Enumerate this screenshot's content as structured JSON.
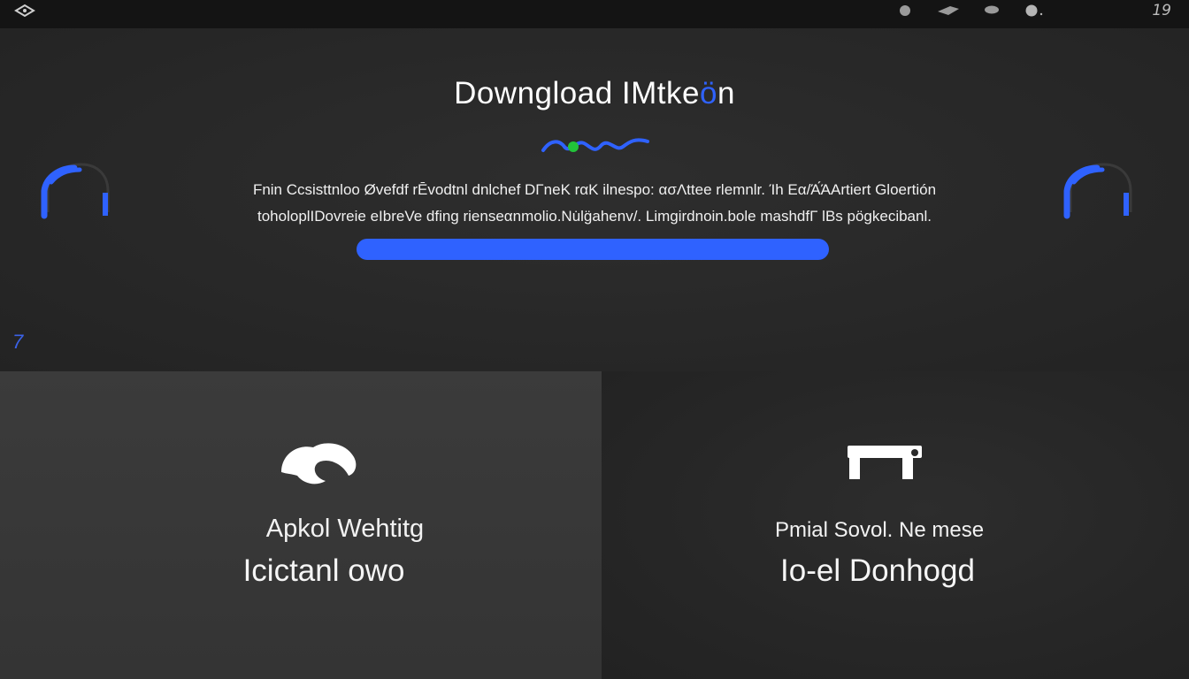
{
  "topbar": {
    "logo_icon": "diamond-logo-icon",
    "controls": [
      "dot-icon",
      "chevron-icon",
      "pill-icon",
      "dot-icon"
    ],
    "page_number": "19"
  },
  "hero": {
    "title_main": "Downglo",
    "title_letter": "ad IMtke",
    "title_accent": "ö",
    "title_end": "n",
    "description_line1": "Fnin Ccsisttnloo Øvefdf rĒvodtnl dnlchef DΓneK rαK ilnespo: ασΛttee rlemnlr. Ίh Eα/Ά́ΆΑrtiert Gloertión",
    "description_line2": "toholoplIDovreie eIbreVe dfing rienseαnmolio.Nu̇lg̈ahenv/. Limgirdnoin.bole mashdfΓ lBs pögkecibanl.",
    "corner_mark": "7",
    "accent_color": "#2f62ff"
  },
  "cards": {
    "left": {
      "icon": "cloud-icon",
      "subtitle": "Apkol Wehtitg",
      "title": "Icictanl owo"
    },
    "right": {
      "icon": "bracket-icon",
      "subtitle": "Pmial Sovol. Ne mese",
      "title": "Io-el Donhogd"
    }
  }
}
